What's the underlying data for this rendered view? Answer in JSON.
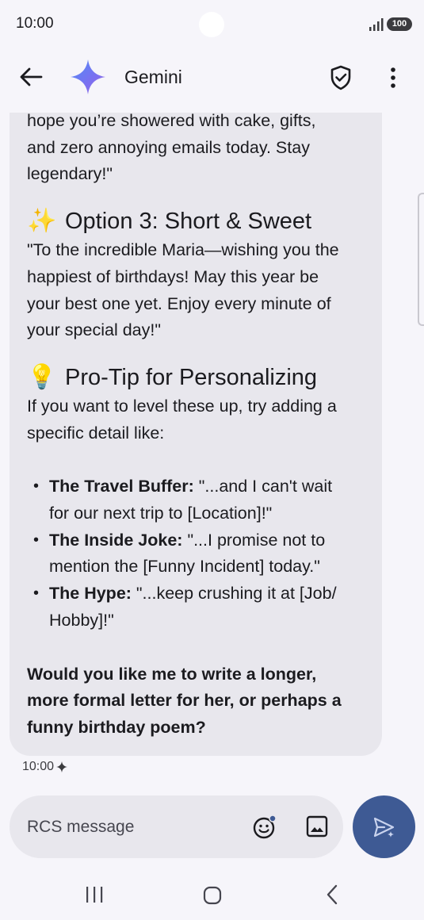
{
  "status_bar": {
    "time": "10:00",
    "battery": "100"
  },
  "app_bar": {
    "title": "Gemini"
  },
  "message": {
    "intro_lines": [
      "hope you’re showered with cake, gifts,",
      "and zero annoying emails today. Stay",
      "legendary!\""
    ],
    "option3": {
      "emoji": "✨",
      "heading": "Option 3: Short & Sweet",
      "lines": [
        "\"To the incredible Maria—wishing you the",
        "happiest of birthdays! May this year be",
        "your best one yet. Enjoy every minute of",
        "your special day!\""
      ]
    },
    "protip": {
      "emoji": "💡",
      "heading": "Pro-Tip for Personalizing",
      "lines": [
        "If you want to level these up, try adding a",
        "specific detail like:"
      ]
    },
    "bullets": [
      {
        "label": "The Travel Buffer:",
        "text": " \"...and I can't wait",
        "text2": "for our next trip to [Location]!\""
      },
      {
        "label": "The Inside Joke:",
        "text": " \"...I promise not to",
        "text2": "mention the [Funny Incident] today.\""
      },
      {
        "label": "The Hype:",
        "text": " \"...keep crushing it at [Job/",
        "text2": "Hobby]!\""
      }
    ],
    "closing_lines": [
      "Would you like me to write a longer,",
      "more formal letter for her, or perhaps a",
      "funny birthday poem?"
    ],
    "timestamp": "10:00"
  },
  "compose": {
    "placeholder": "RCS message"
  },
  "colors": {
    "send_button": "#3e5a94",
    "bubble": "#e8e7ed",
    "background": "#f6f5fa"
  }
}
